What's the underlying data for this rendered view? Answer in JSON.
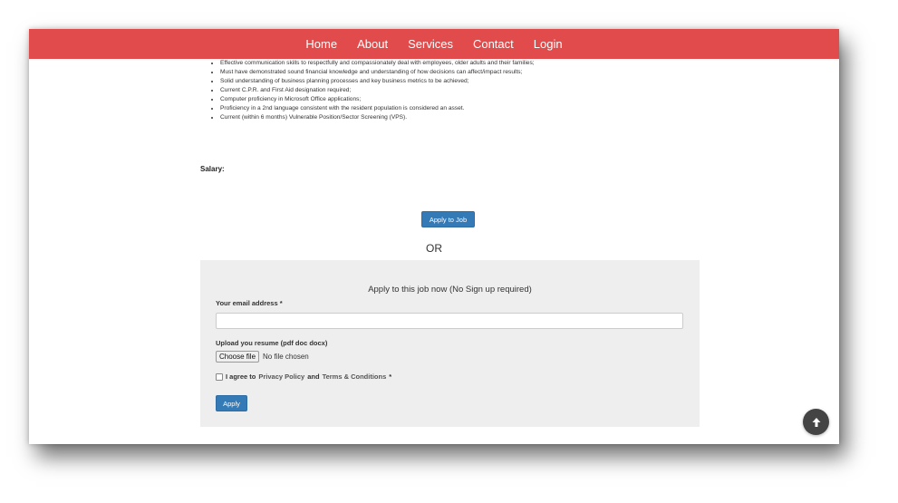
{
  "nav": {
    "items": [
      {
        "label": "Home"
      },
      {
        "label": "About"
      },
      {
        "label": "Services"
      },
      {
        "label": "Contact"
      },
      {
        "label": "Login"
      }
    ]
  },
  "requirements": [
    "Effective communication skills to respectfully and compassionately deal with employees, older adults and their families;",
    "Must have demonstrated sound financial knowledge and understanding of how decisions can affect/impact results;",
    "Solid understanding of business planning processes and key business metrics to be achieved;",
    "Current C.P.R. and First Aid designation required;",
    "Computer proficiency in Microsoft Office applications;",
    "Proficiency in a 2nd language consistent with the resident population is considered an asset.",
    "Current (within 6 months) Vulnerable Position/Sector Screening (VPS)."
  ],
  "salary_label": "Salary:",
  "apply_to_job_label": "Apply to Job",
  "or_label": "OR",
  "apply_form": {
    "title": "Apply to this job now (No Sign up required)",
    "email_label": "Your email address *",
    "email_value": "",
    "resume_label": "Upload you resume (pdf doc docx)",
    "choose_file_label": "Choose file",
    "no_file_text": "No file chosen",
    "agree_prefix": "I agree to",
    "privacy_link": "Privacy Policy",
    "and_text": "and",
    "terms_link": "Terms & Conditions",
    "required_mark": "*",
    "apply_label": "Apply"
  },
  "icons": {
    "scroll_top": "arrow-up-icon"
  },
  "colors": {
    "navbar": "#e24b4b",
    "primary_button": "#337ab7",
    "panel_bg": "#eeeeee"
  }
}
